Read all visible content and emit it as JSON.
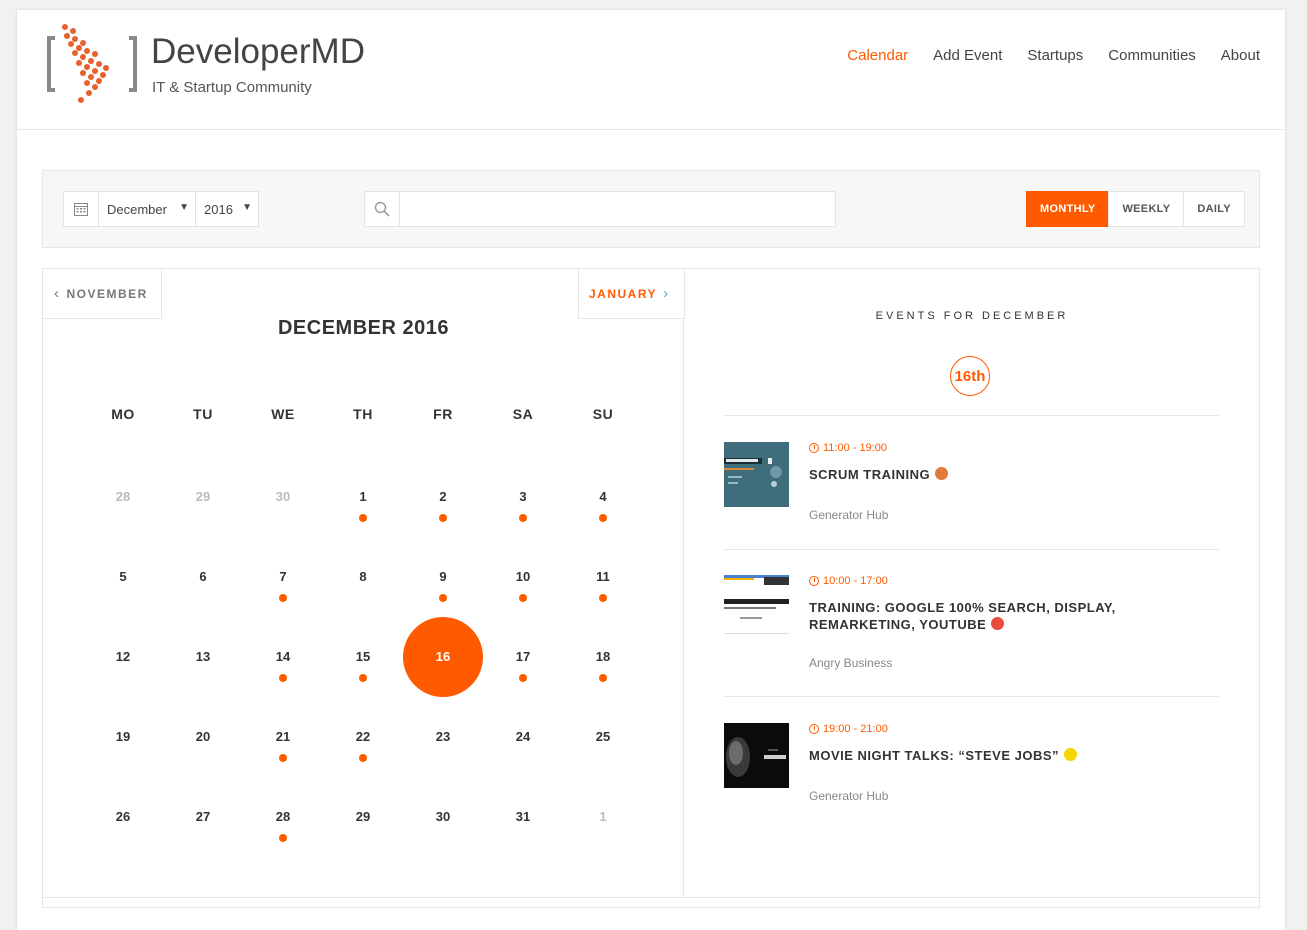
{
  "brand": {
    "title": "DeveloperMD",
    "subtitle": "IT & Startup Community"
  },
  "nav": [
    {
      "label": "Calendar",
      "active": true
    },
    {
      "label": "Add Event",
      "active": false
    },
    {
      "label": "Startups",
      "active": false
    },
    {
      "label": "Communities",
      "active": false
    },
    {
      "label": "About",
      "active": false
    }
  ],
  "filters": {
    "month": "December",
    "year": "2016",
    "search_value": "",
    "views": [
      "MONTHLY",
      "WEEKLY",
      "DAILY"
    ],
    "active_view": "MONTHLY"
  },
  "calendar": {
    "prev_label": "NOVEMBER",
    "next_label": "JANUARY",
    "title": "DECEMBER 2016",
    "weekdays": [
      "MO",
      "TU",
      "WE",
      "TH",
      "FR",
      "SA",
      "SU"
    ],
    "days": [
      {
        "n": "28",
        "muted": true,
        "dot": false
      },
      {
        "n": "29",
        "muted": true,
        "dot": false
      },
      {
        "n": "30",
        "muted": true,
        "dot": false
      },
      {
        "n": "1",
        "muted": false,
        "dot": true
      },
      {
        "n": "2",
        "muted": false,
        "dot": true
      },
      {
        "n": "3",
        "muted": false,
        "dot": true
      },
      {
        "n": "4",
        "muted": false,
        "dot": true
      },
      {
        "n": "5",
        "muted": false,
        "dot": false
      },
      {
        "n": "6",
        "muted": false,
        "dot": false
      },
      {
        "n": "7",
        "muted": false,
        "dot": true
      },
      {
        "n": "8",
        "muted": false,
        "dot": false
      },
      {
        "n": "9",
        "muted": false,
        "dot": true
      },
      {
        "n": "10",
        "muted": false,
        "dot": true
      },
      {
        "n": "11",
        "muted": false,
        "dot": true
      },
      {
        "n": "12",
        "muted": false,
        "dot": false
      },
      {
        "n": "13",
        "muted": false,
        "dot": false
      },
      {
        "n": "14",
        "muted": false,
        "dot": true
      },
      {
        "n": "15",
        "muted": false,
        "dot": true
      },
      {
        "n": "16",
        "muted": false,
        "dot": false,
        "selected": true
      },
      {
        "n": "17",
        "muted": false,
        "dot": true
      },
      {
        "n": "18",
        "muted": false,
        "dot": true
      },
      {
        "n": "19",
        "muted": false,
        "dot": false
      },
      {
        "n": "20",
        "muted": false,
        "dot": false
      },
      {
        "n": "21",
        "muted": false,
        "dot": true
      },
      {
        "n": "22",
        "muted": false,
        "dot": true
      },
      {
        "n": "23",
        "muted": false,
        "dot": false
      },
      {
        "n": "24",
        "muted": false,
        "dot": false
      },
      {
        "n": "25",
        "muted": false,
        "dot": false
      },
      {
        "n": "26",
        "muted": false,
        "dot": false
      },
      {
        "n": "27",
        "muted": false,
        "dot": false
      },
      {
        "n": "28",
        "muted": false,
        "dot": true
      },
      {
        "n": "29",
        "muted": false,
        "dot": false
      },
      {
        "n": "30",
        "muted": false,
        "dot": false
      },
      {
        "n": "31",
        "muted": false,
        "dot": false
      },
      {
        "n": "1",
        "muted": true,
        "dot": false
      }
    ]
  },
  "events_panel": {
    "title": "EVENTS FOR DECEMBER",
    "date_badge": "16th",
    "events": [
      {
        "time": "11:00 - 19:00",
        "title": "SCRUM TRAINING",
        "color": "#e07b39",
        "venue": "Generator Hub",
        "thumb": "scrum-training-thumbnail"
      },
      {
        "time": "10:00 - 17:00",
        "title": "TRAINING: GOOGLE 100% SEARCH, DISPLAY, REMARKETING, YOUTUBE",
        "color": "#e84c3d",
        "venue": "Angry Business",
        "thumb": "google-training-thumbnail"
      },
      {
        "time": "19:00 - 21:00",
        "title": "MOVIE NIGHT TALKS: “STEVE JOBS”",
        "color": "#f5d500",
        "venue": "Generator Hub",
        "thumb": "steve-jobs-thumbnail"
      }
    ]
  },
  "colors": {
    "accent": "#ff5a00",
    "text": "#333333",
    "muted": "#bbbbbb"
  }
}
